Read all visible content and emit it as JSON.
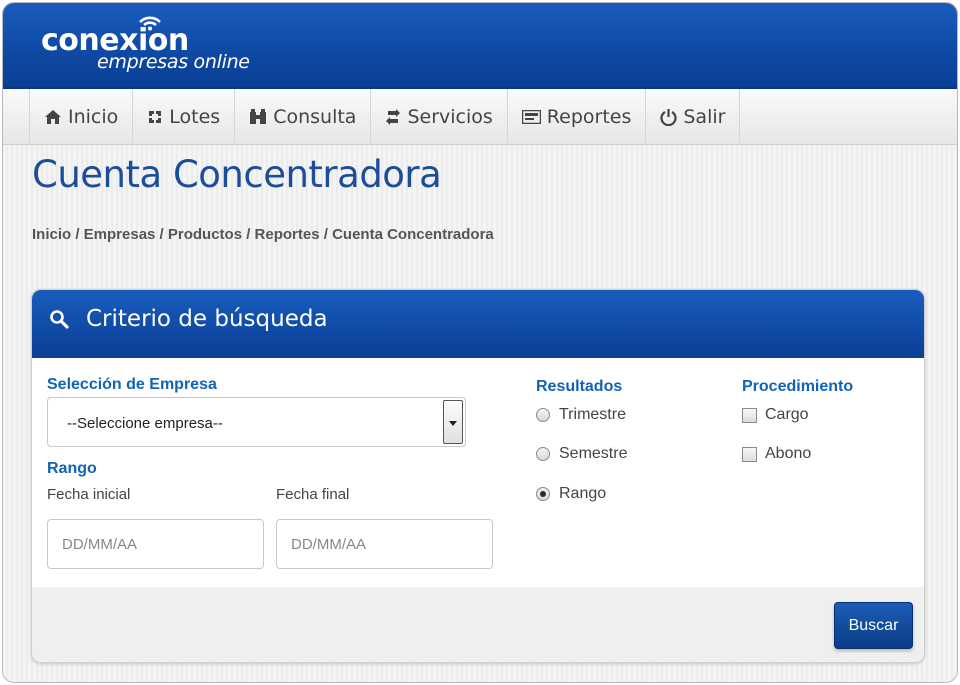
{
  "brand": {
    "name": "conexion",
    "tagline": "empresas online"
  },
  "nav": {
    "items": [
      {
        "label": "Inicio",
        "icon": "home-icon"
      },
      {
        "label": "Lotes",
        "icon": "lotes-icon"
      },
      {
        "label": "Consulta",
        "icon": "consulta-icon"
      },
      {
        "label": "Servicios",
        "icon": "servicios-icon"
      },
      {
        "label": "Reportes",
        "icon": "reportes-icon"
      },
      {
        "label": "Salir",
        "icon": "power-icon"
      }
    ]
  },
  "page": {
    "title": "Cuenta Concentradora",
    "breadcrumb": "Inicio / Empresas / Productos / Reportes / Cuenta Concentradora"
  },
  "panel": {
    "title": "Criterio de búsqueda",
    "empresa": {
      "label": "Selección de Empresa",
      "selected": "--Seleccione empresa--"
    },
    "rango": {
      "label": "Rango",
      "fecha_inicial": {
        "label": "Fecha inicial",
        "placeholder": "DD/MM/AA"
      },
      "fecha_final": {
        "label": "Fecha final",
        "placeholder": "DD/MM/AA"
      }
    },
    "resultados": {
      "label": "Resultados",
      "options": [
        {
          "label": "Trimestre",
          "selected": false
        },
        {
          "label": "Semestre",
          "selected": false
        },
        {
          "label": "Rango",
          "selected": true
        }
      ]
    },
    "procedimiento": {
      "label": "Procedimiento",
      "options": [
        {
          "label": "Cargo",
          "checked": false
        },
        {
          "label": "Abono",
          "checked": false
        }
      ]
    },
    "search_button": "Buscar"
  },
  "colors": {
    "brand_blue": "#0f4aa6",
    "label_blue": "#1164b5",
    "title_blue": "#1b4d9a"
  }
}
